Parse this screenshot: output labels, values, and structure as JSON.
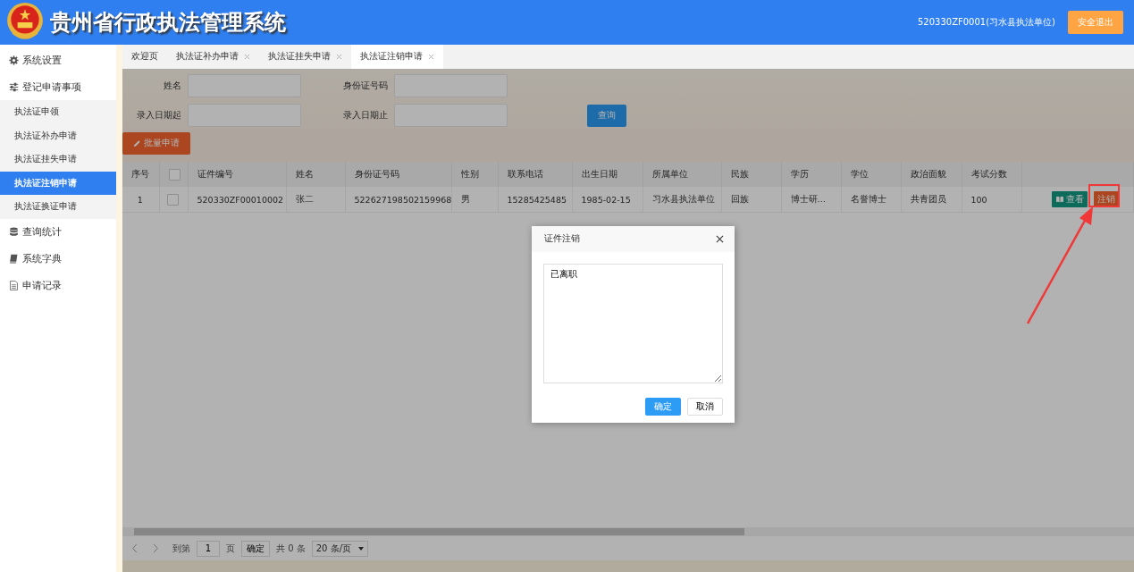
{
  "header": {
    "title": "贵州省行政执法管理系统",
    "user": "520330ZF0001(习水县执法单位)",
    "logout": "安全退出"
  },
  "sidebar": [
    {
      "label": "系统设置"
    },
    {
      "label": "登记申请事项",
      "children": [
        {
          "label": "执法证申领",
          "selected": false
        },
        {
          "label": "执法证补办申请",
          "selected": false
        },
        {
          "label": "执法证挂失申请",
          "selected": false
        },
        {
          "label": "执法证注销申请",
          "selected": true
        },
        {
          "label": "执法证换证申请",
          "selected": false
        }
      ]
    },
    {
      "label": "查询统计"
    },
    {
      "label": "系统字典"
    },
    {
      "label": "申请记录"
    }
  ],
  "tabs": [
    {
      "label": "欢迎页",
      "closable": false,
      "selected": false
    },
    {
      "label": "执法证补办申请",
      "closable": true,
      "selected": false
    },
    {
      "label": "执法证挂失申请",
      "closable": true,
      "selected": false
    },
    {
      "label": "执法证注销申请",
      "closable": true,
      "selected": true
    }
  ],
  "filters": [
    {
      "label": "姓名"
    },
    {
      "label": "身份证号码"
    },
    {
      "label": "录入日期起"
    },
    {
      "label": "录入日期止"
    }
  ],
  "query_button": "查询",
  "batch_button": "批量申请",
  "table": {
    "columns": [
      "序号",
      "",
      "证件编号",
      "姓名",
      "身份证号码",
      "性别",
      "联系电话",
      "出生日期",
      "所属单位",
      "民族",
      "学历",
      "学位",
      "政治面貌",
      "考试分数"
    ],
    "header_checked": false,
    "rows": [
      {
        "checked": false,
        "cells": [
          "1",
          "",
          "520330ZF00010002",
          "张二",
          "522627198502159968",
          "男",
          "15285425485",
          "1985-02-15",
          "习水县执法单位",
          "回族",
          "博士研…",
          "名誉博士",
          "共青团员",
          "100"
        ],
        "actions": [
          {
            "kind": "view",
            "label": "查看"
          },
          {
            "kind": "revoke",
            "label": "注销"
          }
        ]
      }
    ]
  },
  "pagination": {
    "goto": "到第",
    "page": "1",
    "page_unit": "页",
    "confirm": "确定",
    "total": "共 0 条",
    "page_size": "20 条/页"
  },
  "dialog": {
    "title": "证件注销",
    "value": "已离职",
    "ok": "确定",
    "cancel": "取消"
  }
}
